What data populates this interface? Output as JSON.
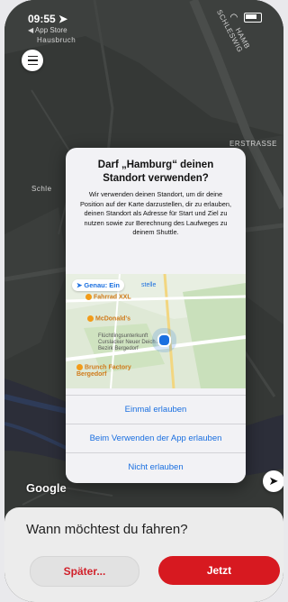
{
  "status_bar": {
    "time": "09:55",
    "back_app": "◀ App Store",
    "icons": [
      "location-arrow-icon",
      "wifi-icon",
      "battery-icon"
    ]
  },
  "map": {
    "streets": [
      "SCHLESWIG",
      "HAMB",
      "Curslacker Neuer Deich",
      "Schle",
      "ERSTRASSE"
    ],
    "place_top": "Hausbruch",
    "attribution": "Google",
    "icons": [
      "menu-icon",
      "location-arrow-icon"
    ]
  },
  "dialog": {
    "title": "Darf „Hamburg“ deinen Standort verwenden?",
    "message": "Wir verwenden deinen Standort, um dir deine Position auf der Karte darzustellen, dir zu erlauben, deinen Standort als Adresse für Start und Ziel zu nutzen sowie zur Berechnung des Laufweges zu deinem Shuttle.",
    "precise_label": "Genau: Ein",
    "precise_tail": "stelle",
    "map_pois": {
      "fahrrad": "Fahrrad XXL",
      "mcdonalds": "McDonald's",
      "shelter": "Flüchtlingsunterkunft Curslacker Neuer Deich / Bezirk Bergedorf",
      "brunch": "Brunch Factory Bergedorf"
    },
    "buttons": {
      "once": "Einmal erlauben",
      "while_using": "Beim Verwenden der App erlauben",
      "deny": "Nicht erlauben"
    }
  },
  "sheet": {
    "question": "Wann möchtest du fahren?",
    "later": "Später...",
    "now": "Jetzt"
  },
  "colors": {
    "accent_red": "#d71920",
    "ios_blue": "#1a6fe0",
    "map_dark": "#2f3230"
  }
}
